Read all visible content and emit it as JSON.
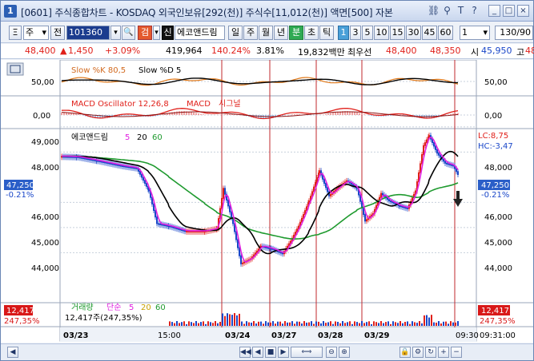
{
  "window": {
    "badge": "1",
    "title": "[0601] 주식종합차트 - KOSDAQ 외국인보유[292(천)] 주식수[11,012(천)] 액면[500] 자본",
    "icons": [
      "link-icon",
      "pin-icon",
      "translate-icon",
      "help-icon"
    ],
    "tb_glyphs": {
      "link": "⛓",
      "pin": "⚲",
      "translate": "T",
      "help": "?"
    },
    "btn_glyphs": {
      "min": "_",
      "max": "□",
      "close": "×"
    }
  },
  "toolbar": {
    "chart_menu": "Ξ",
    "type": "주",
    "type_arrow": "▾",
    "prefix": "전",
    "code": "101360",
    "search": "🔍",
    "favorite": "검",
    "new_badge": "신",
    "stock_name": "에코앤드림",
    "periods": [
      "일",
      "주",
      "월",
      "년",
      "분",
      "초",
      "틱"
    ],
    "active_period": "분",
    "minute_options": [
      "1",
      "3",
      "5",
      "10",
      "15",
      "30",
      "45",
      "60"
    ],
    "active_minute": "1",
    "unit_value": "1",
    "count": "130/90"
  },
  "info": {
    "price": "48,400",
    "change": "1,450",
    "change_pct": "+3.09%",
    "volume": "419,964",
    "vol_ratio": "140.24%",
    "turnover": "3.81%",
    "amount": "19,832백만",
    "best_ask_label": "최우선",
    "best_ask": "48,400",
    "best_bid": "48,350",
    "open_label": "시",
    "open": "45,950",
    "high_label": "고",
    "high": "48"
  },
  "panes": {
    "slow": {
      "title": "Slow %K 80,5",
      "title2": "Slow %D 5",
      "ticks": [
        "50,00"
      ]
    },
    "macd": {
      "title": "MACD Oscillator 12,26,8",
      "title2": "MACD",
      "title3": "시그널",
      "ticks": [
        "0,00"
      ]
    },
    "price": {
      "title": "에코앤드림",
      "ma": [
        "5",
        "20",
        "60"
      ],
      "ticks": [
        "49,000",
        "48,000",
        "46,000",
        "45,000",
        "44,000"
      ],
      "right_ticks": [
        "48,000",
        "46,000",
        "45,000",
        "44,000",
        "49,000"
      ],
      "current": "47,250",
      "current_pct": "-0.21%",
      "lc": "LC:8,75",
      "hc": "HC:-3,47"
    },
    "volume": {
      "title": "거래량",
      "ma_label": "단순",
      "ma": [
        "5",
        "20",
        "60"
      ],
      "value": "12,417",
      "value_pct": "247,35%",
      "value_line": "12,417주(247,35%)"
    }
  },
  "x_axis": {
    "labels": [
      "03/23",
      "15:00",
      "03/24",
      "03/27",
      "03/28",
      "03/29",
      "09:30"
    ],
    "time_readout": "09:31:00"
  },
  "colors": {
    "price_line_black": "#000000",
    "ma5_magenta": "#e020e0",
    "ma60_green": "#1e9a2e",
    "ma20_green": "#0c7a1c",
    "candle_up": "#e0201a",
    "candle_down": "#1a47c9",
    "day_separator": "#c0282e",
    "current_tag": "#2a5ec8",
    "volume_tag": "#d81818"
  },
  "bottom_bar": {
    "controls": [
      "first",
      "rewind",
      "prev",
      "stop",
      "next",
      "slider",
      "zoom-out",
      "zoom-in",
      "lock",
      "settings",
      "refresh",
      "expand",
      "shrink"
    ],
    "glyphs": [
      "◀",
      "◀◀",
      "◀",
      "■",
      "▶",
      "⟺",
      "⊖",
      "⊕",
      "🔒",
      "⚙",
      "↻",
      "+",
      "−"
    ]
  }
}
